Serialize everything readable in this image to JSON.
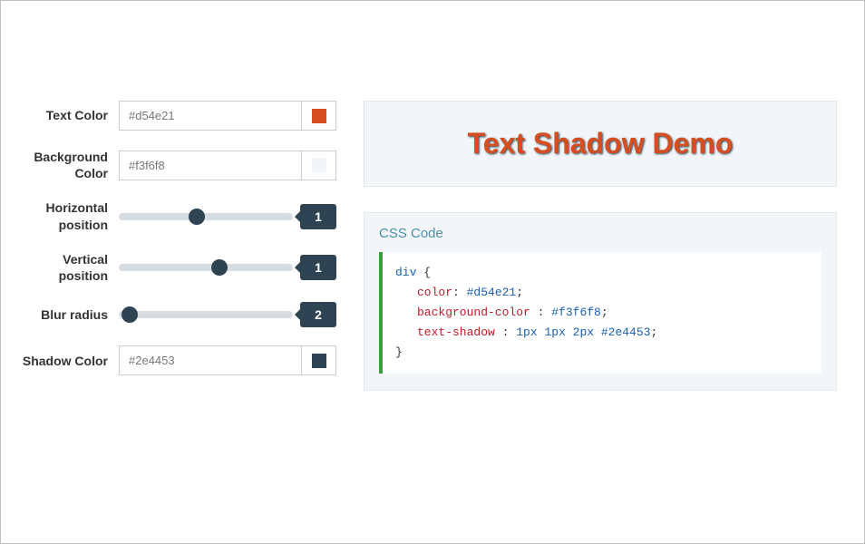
{
  "controls": {
    "text_color": {
      "label": "Text Color",
      "value": "#d54e21",
      "swatch": "#d54e21"
    },
    "background_color": {
      "label": "Background Color",
      "value": "#f3f6f8",
      "swatch": "#f3f6f8"
    },
    "horizontal": {
      "label": "Horizontal position",
      "value": "1",
      "percent": 45
    },
    "vertical": {
      "label": "Vertical position",
      "value": "1",
      "percent": 58
    },
    "blur": {
      "label": "Blur radius",
      "value": "2",
      "percent": 6
    },
    "shadow_color": {
      "label": "Shadow Color",
      "value": "#2e4453",
      "swatch": "#2e4453"
    }
  },
  "demo": {
    "text": "Text Shadow Demo"
  },
  "code": {
    "title": "CSS Code",
    "selector": "div",
    "open": "{",
    "close": "}",
    "lines": [
      {
        "prop": "color",
        "sep": ": ",
        "val": "#d54e21",
        "end": ";"
      },
      {
        "prop": "background-color",
        "sep": " : ",
        "val": "#f3f6f8",
        "end": ";"
      },
      {
        "prop": "text-shadow",
        "sep": " : ",
        "val": "1px 1px 2px #2e4453",
        "end": ";"
      }
    ]
  }
}
